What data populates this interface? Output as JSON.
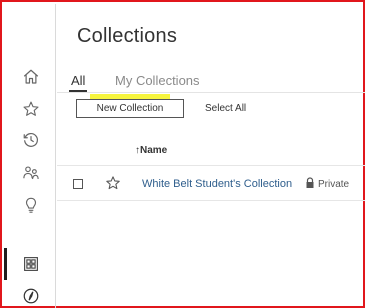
{
  "header": {
    "title": "Collections"
  },
  "tabs": [
    {
      "label": "All",
      "active": true
    },
    {
      "label": "My Collections",
      "active": false
    }
  ],
  "toolbar": {
    "new_collection_label": "New Collection",
    "select_all_label": "Select All"
  },
  "table": {
    "sort_indicator": "↑",
    "name_header": "Name",
    "rows": [
      {
        "name": "White Belt Student's Collection",
        "visibility": "Private"
      }
    ]
  },
  "sidebar": {
    "items": [
      {
        "icon": "home-icon"
      },
      {
        "icon": "star-icon"
      },
      {
        "icon": "clock-icon"
      },
      {
        "icon": "users-icon"
      },
      {
        "icon": "lightbulb-icon"
      },
      {
        "icon": "collections-icon",
        "active": true
      },
      {
        "icon": "compass-icon"
      }
    ]
  },
  "colors": {
    "frame_border": "#e1171c",
    "highlight": "#f5f21c",
    "link": "#2f5e8c"
  }
}
